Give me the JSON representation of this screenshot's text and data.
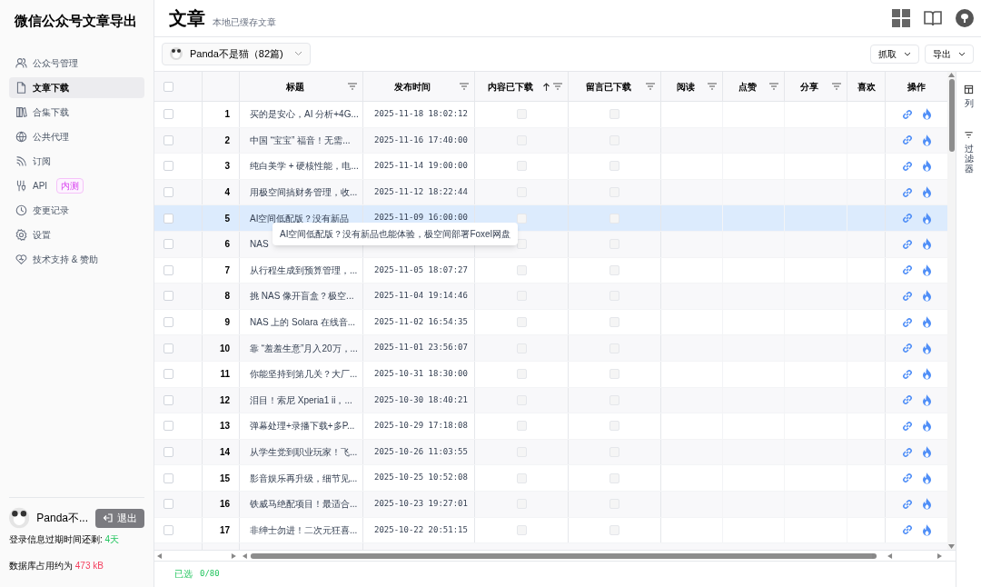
{
  "app_title": "微信公众号文章导出",
  "nav": [
    {
      "label": "公众号管理",
      "selected": false
    },
    {
      "label": "文章下载",
      "selected": true
    },
    {
      "label": "合集下载",
      "selected": false
    },
    {
      "label": "公共代理",
      "selected": false
    },
    {
      "label": "订阅",
      "selected": false
    },
    {
      "label": "API",
      "selected": false,
      "badge": "内测"
    },
    {
      "label": "变更记录",
      "selected": false
    },
    {
      "label": "设置",
      "selected": false
    },
    {
      "label": "技术支持 & 赞助",
      "selected": false
    }
  ],
  "user": {
    "name": "Panda不...",
    "logout": "退出",
    "expiry_label": "登录信息过期时间还剩:",
    "expiry_value": "4天",
    "db_label": "数据库占用约为",
    "db_value": "473 kB"
  },
  "page": {
    "title": "文章",
    "subtitle": "本地已缓存文章"
  },
  "account_select": {
    "value": "Panda不是猫（82篇)"
  },
  "actions": [
    {
      "label": "抓取"
    },
    {
      "label": "导出"
    }
  ],
  "columns": [
    {
      "label": "标题",
      "filter": true,
      "sorted_ascending": false
    },
    {
      "label": "发布时间",
      "filter": true,
      "sorted_ascending": false
    },
    {
      "label": "内容已下载",
      "filter": true,
      "sorted_ascending": true
    },
    {
      "label": "留言已下载",
      "filter": true,
      "sorted_ascending": false
    },
    {
      "label": "阅读",
      "filter": true,
      "sorted_ascending": false
    },
    {
      "label": "点赞",
      "filter": true,
      "sorted_ascending": false
    },
    {
      "label": "分享",
      "filter": true,
      "sorted_ascending": false
    },
    {
      "label": "喜欢",
      "filter": false,
      "sorted_ascending": false
    },
    {
      "label": "操作",
      "filter": false,
      "sorted_ascending": false
    }
  ],
  "header_checked": false,
  "rows": [
    {
      "index": "1",
      "title": "买的是安心，AI 分析+4G...",
      "date": "2025-11-18 18:02:12",
      "checked": false,
      "hovered": false
    },
    {
      "index": "2",
      "title": "中国 “宝宝” 福音！无需...",
      "date": "2025-11-16 17:40:00",
      "checked": false,
      "hovered": false
    },
    {
      "index": "3",
      "title": "纯白美学 + 硬核性能，电...",
      "date": "2025-11-14 19:00:00",
      "checked": false,
      "hovered": false
    },
    {
      "index": "4",
      "title": "用极空间搞财务管理，收...",
      "date": "2025-11-12 18:22:44",
      "checked": false,
      "hovered": false
    },
    {
      "index": "5",
      "title": "AI空间低配版？没有新品",
      "date": "2025-11-09 16:00:00",
      "checked": false,
      "hovered": true
    },
    {
      "index": "6",
      "title": "NAS",
      "checked": false,
      "hovered": false
    },
    {
      "index": "7",
      "title": "从行程生成到预算管理，...",
      "date": "2025-11-05 18:07:27",
      "checked": false,
      "hovered": false
    },
    {
      "index": "8",
      "title": "挑 NAS 像开盲盒？极空...",
      "date": "2025-11-04 19:14:46",
      "checked": false,
      "hovered": false
    },
    {
      "index": "9",
      "title": "NAS 上的 Solara 在线音...",
      "date": "2025-11-02 16:54:35",
      "checked": false,
      "hovered": false
    },
    {
      "index": "10",
      "title": "靠 “羞羞生意”月入20万，...",
      "date": "2025-11-01 23:56:07",
      "checked": false,
      "hovered": false
    },
    {
      "index": "11",
      "title": "你能坚持到第几关？大厂...",
      "date": "2025-10-31 18:30:00",
      "checked": false,
      "hovered": false
    },
    {
      "index": "12",
      "title": "泪目！索尼 Xperia1 ii，...",
      "date": "2025-10-30 18:40:21",
      "checked": false,
      "hovered": false
    },
    {
      "index": "13",
      "title": "弹幕处理+录播下载+多P...",
      "date": "2025-10-29 17:18:08",
      "checked": false,
      "hovered": false
    },
    {
      "index": "14",
      "title": "从学生党到职业玩家！飞...",
      "date": "2025-10-26 11:03:55",
      "checked": false,
      "hovered": false
    },
    {
      "index": "15",
      "title": "影音娱乐再升级，细节见...",
      "date": "2025-10-25 10:52:08",
      "checked": false,
      "hovered": false
    },
    {
      "index": "16",
      "title": "铁威马绝配项目！最适合...",
      "date": "2025-10-23 19:27:01",
      "checked": false,
      "hovered": false
    },
    {
      "index": "17",
      "title": "非绅士勿进！二次元狂喜...",
      "date": "2025-10-22 20:51:15",
      "checked": false,
      "hovered": false
    }
  ],
  "tooltip": "AI空间低配版？没有新品也能体验，极空间部署Foxel网盘",
  "side_panel": [
    {
      "label": "列"
    },
    {
      "label": "过滤器"
    }
  ],
  "footer": {
    "selected_label": "已选",
    "selected_count": "0/80"
  }
}
